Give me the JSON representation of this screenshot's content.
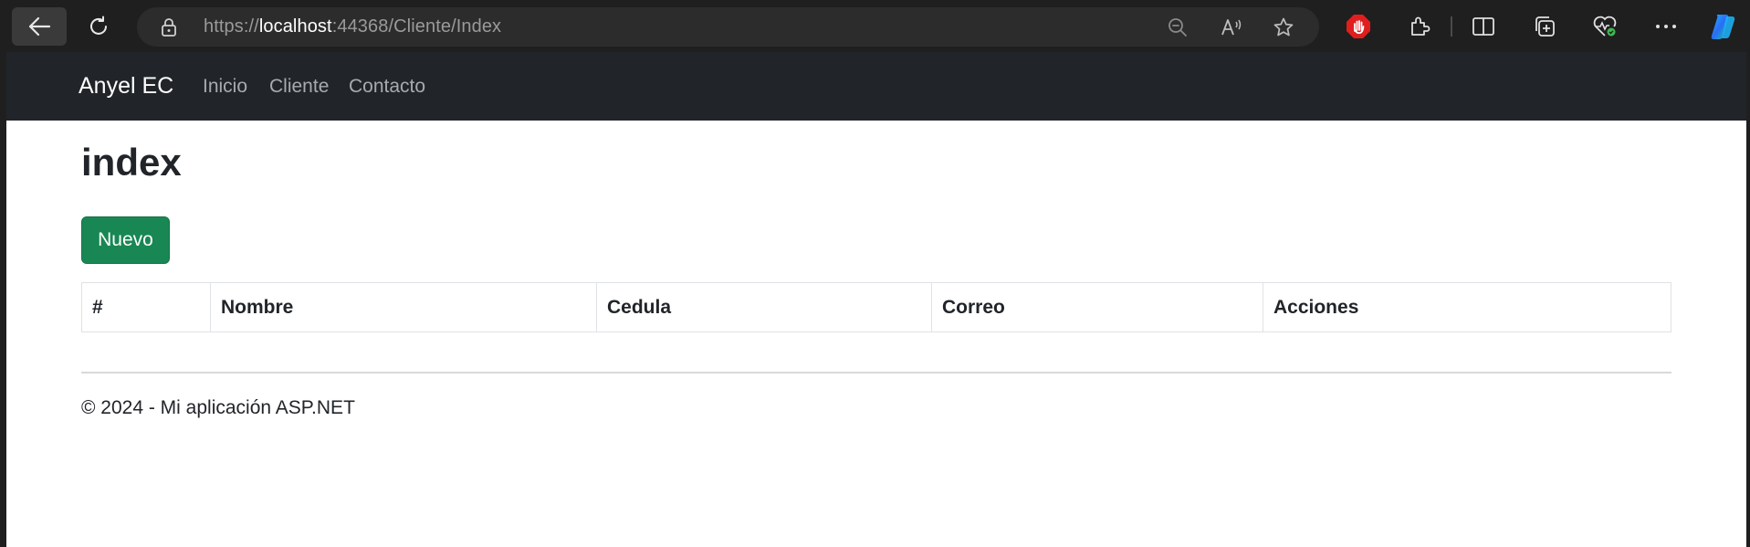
{
  "browser": {
    "url_scheme": "https://",
    "url_host": "localhost",
    "url_rest": ":44368/Cliente/Index",
    "icons": [
      "back-arrow-icon",
      "reload-icon",
      "lock-icon",
      "zoom-out-icon",
      "read-aloud-icon",
      "favorite-star-icon",
      "stop-hand-icon",
      "extensions-icon",
      "split-screen-icon",
      "collections-icon",
      "browser-essentials-icon",
      "more-icon",
      "copilot-icon"
    ]
  },
  "navbar": {
    "brand": "Anyel EC",
    "links": [
      {
        "label": "Inicio"
      },
      {
        "label": "Cliente"
      },
      {
        "label": "Contacto"
      }
    ]
  },
  "main": {
    "title": "index",
    "new_button": "Nuevo",
    "table": {
      "columns": [
        "#",
        "Nombre",
        "Cedula",
        "Correo",
        "Acciones"
      ],
      "rows": []
    }
  },
  "footer": {
    "text": "© 2024 - Mi aplicación ASP.NET"
  },
  "colors": {
    "navbar_bg": "#212529",
    "success_button": "#198754",
    "chrome_bg": "#1f1f1f"
  }
}
